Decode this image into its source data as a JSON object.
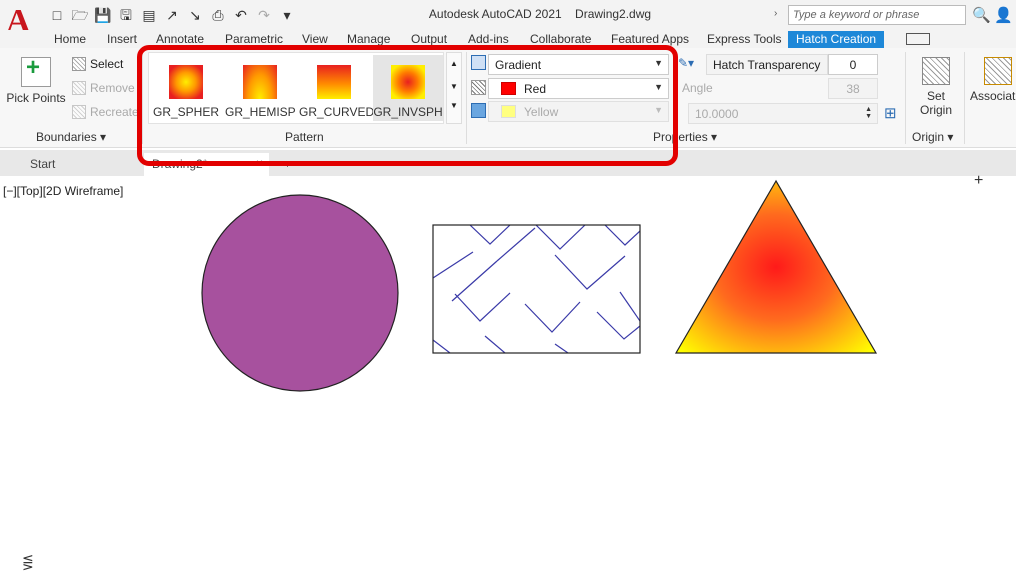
{
  "titlebar": {
    "app_title": "Autodesk AutoCAD 2021",
    "file_name": "Drawing2.dwg",
    "search_placeholder": "Type a keyword or phrase",
    "logo": "A"
  },
  "tabs": [
    "Home",
    "Insert",
    "Annotate",
    "Parametric",
    "View",
    "Manage",
    "Output",
    "Add-ins",
    "Collaborate",
    "Featured Apps",
    "Express Tools",
    "Hatch Creation"
  ],
  "active_tab": "Hatch Creation",
  "boundaries": {
    "pick_points": "Pick Points",
    "select": "Select",
    "remove": "Remove",
    "recreate": "Recreate",
    "panel_title": "Boundaries"
  },
  "pattern": {
    "panel_title": "Pattern",
    "items": [
      {
        "label": "GR_SPHER"
      },
      {
        "label": "GR_HEMISP"
      },
      {
        "label": "GR_CURVED"
      },
      {
        "label": "GR_INVSPH"
      }
    ],
    "selected": "GR_INVSPH"
  },
  "properties": {
    "panel_title": "Properties",
    "hatch_type": "Gradient",
    "color1": "Red",
    "color1_hex": "#ff0000",
    "color2": "Yellow",
    "color2_hex": "#ffff80",
    "transparency_label": "Hatch Transparency",
    "transparency_value": "0",
    "angle_label": "Angle",
    "angle_value": "38",
    "tint_value": "10.0000"
  },
  "origin": {
    "set_origin": "Set Origin",
    "panel_title": "Origin"
  },
  "options": {
    "associative": "Associative"
  },
  "file_tabs": [
    "Start",
    "Drawing2*"
  ],
  "viewport": {
    "label": "[−][Top][2D Wireframe]"
  },
  "drawing": {
    "circle_fill": "#a7519e",
    "line_pattern_color": "#3a3aa8",
    "gradient_inner": "#ff2020",
    "gradient_outer": "#ffff00"
  }
}
